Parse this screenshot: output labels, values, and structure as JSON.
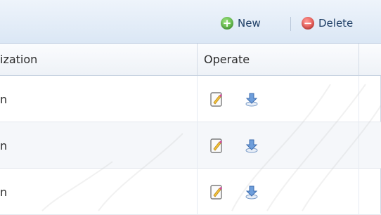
{
  "toolbar": {
    "new_label": "New",
    "delete_label": "Delete",
    "new_icon": "plus-circle-icon",
    "delete_icon": "minus-circle-icon",
    "new_icon_glyph": "+",
    "delete_icon_glyph": "−"
  },
  "table": {
    "columns": [
      "ization",
      "Operate"
    ],
    "rows": [
      {
        "org": "n",
        "actions": [
          "edit-icon",
          "download-icon"
        ]
      },
      {
        "org": "n",
        "actions": [
          "edit-icon",
          "download-icon"
        ]
      },
      {
        "org": "n",
        "actions": [
          "edit-icon",
          "download-icon"
        ]
      }
    ]
  },
  "colors": {
    "toolbar_bg": "#dbe7f5",
    "new_icon": "#3f9f2b",
    "delete_icon": "#d12f2a",
    "text": "#2b2b2b",
    "alt_row": "#f5f7fa"
  }
}
